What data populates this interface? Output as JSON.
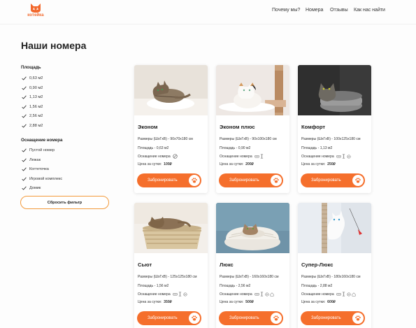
{
  "brand": {
    "logo_text": "котейка"
  },
  "nav": [
    {
      "label": "Почему мы?"
    },
    {
      "label": "Номера"
    },
    {
      "label": "Отзывы"
    },
    {
      "label": "Как нас найти"
    }
  ],
  "page_title": "Наши номера",
  "filters": {
    "area": {
      "title": "Площадь",
      "items": [
        {
          "label": "0,63 м2",
          "checked": true
        },
        {
          "label": "0,90 м2",
          "checked": true
        },
        {
          "label": "1,13 м2",
          "checked": true
        },
        {
          "label": "1,56 м2",
          "checked": true
        },
        {
          "label": "2,56 м2",
          "checked": true
        },
        {
          "label": "2,88 м2",
          "checked": true
        }
      ]
    },
    "equipment": {
      "title": "Оснащение номера",
      "items": [
        {
          "label": "Пустой номер",
          "checked": true
        },
        {
          "label": "Лежак",
          "checked": true
        },
        {
          "label": "Когтеточка",
          "checked": true
        },
        {
          "label": "Игровой комплекс",
          "checked": true
        },
        {
          "label": "Домик",
          "checked": true
        }
      ]
    },
    "reset_label": "Сбросить фильтр"
  },
  "card_labels": {
    "size": "Размеры (ШхГхВ) -",
    "area": "Площадь -",
    "equipment": "Оснащение номера",
    "price": "Цена за сутки:",
    "book": "Забронировать"
  },
  "rooms": [
    {
      "name": "Эконом",
      "size": "90х70х180 см",
      "area": "0,63 м2",
      "price": "100₽",
      "icons": [
        "none-icon"
      ]
    },
    {
      "name": "Эконом плюс",
      "size": "90х100х180 см",
      "area": "0,90 м2",
      "price": "200₽",
      "icons": [
        "bed-icon",
        "scratcher-icon"
      ]
    },
    {
      "name": "Комфорт",
      "size": "100х125х180 см",
      "area": "1,13 м2",
      "price": "250₽",
      "icons": [
        "bed-icon",
        "scratcher-icon",
        "toy-icon"
      ]
    },
    {
      "name": "Сьют",
      "size": "125х125х180 см",
      "area": "1,56 м2",
      "price": "350₽",
      "icons": [
        "bed-icon",
        "scratcher-icon",
        "toy-icon"
      ]
    },
    {
      "name": "Люкс",
      "size": "160х160х180 см",
      "area": "2,56 м2",
      "price": "500₽",
      "icons": [
        "bed-icon",
        "scratcher-icon",
        "toy-icon",
        "house-icon"
      ]
    },
    {
      "name": "Супер-Люкс",
      "size": "180х160х180 см",
      "area": "2,88 м2",
      "price": "600₽",
      "icons": [
        "bed-icon",
        "scratcher-icon",
        "toy-icon",
        "house-icon"
      ]
    }
  ],
  "colors": {
    "accent": "#f56f2c",
    "outline": "#f39a3b"
  }
}
